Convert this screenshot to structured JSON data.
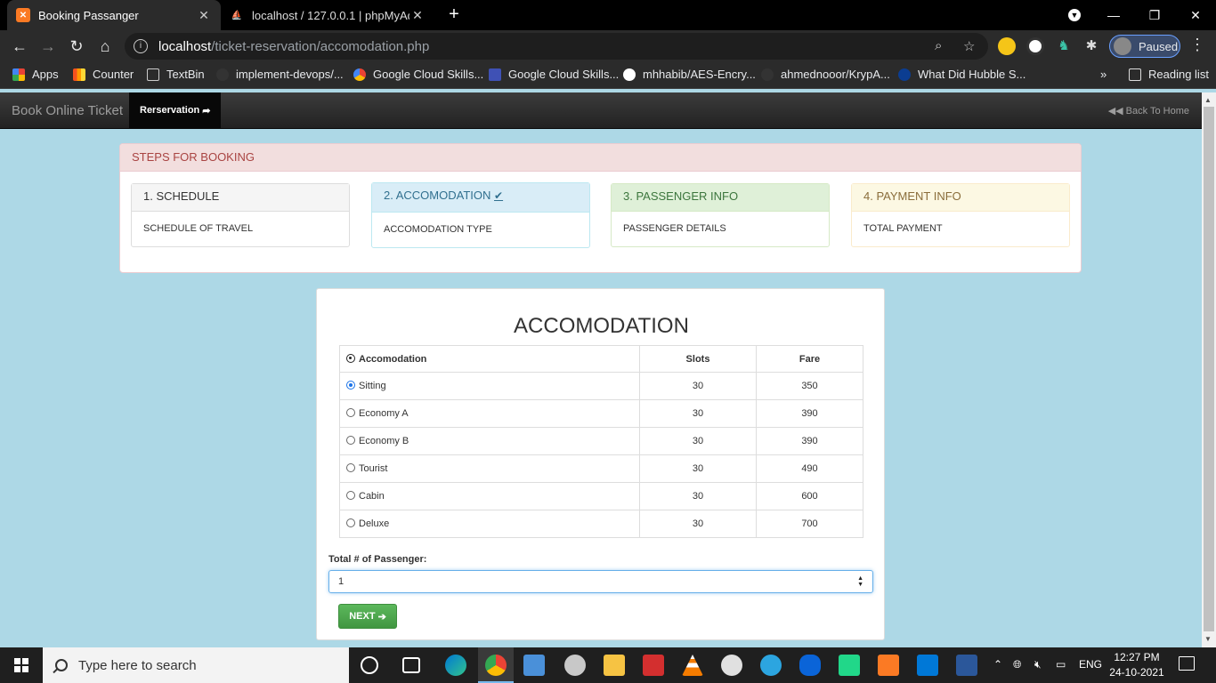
{
  "browser": {
    "tabs": [
      {
        "title": "Booking Passanger",
        "active": true
      },
      {
        "title": "localhost / 127.0.0.1 | phpMyAdm",
        "active": false
      }
    ],
    "url_host": "localhost",
    "url_path": "/ticket-reservation/accomodation.php",
    "profile_label": "Paused",
    "bookmarks": [
      "Apps",
      "Counter",
      "TextBin",
      "implement-devops/...",
      "Google Cloud Skills...",
      "Google Cloud Skills...",
      "mhhabib/AES-Encry...",
      "ahmednooor/KrypA...",
      "What Did Hubble S..."
    ],
    "reading_list": "Reading list",
    "overflow": "»"
  },
  "nav": {
    "brand": "Book Online Ticket",
    "active": "Rerservation",
    "back": "Back To Home"
  },
  "steps": {
    "heading": "STEPS FOR BOOKING",
    "items": [
      {
        "title": "1. SCHEDULE",
        "body": "SCHEDULE OF TRAVEL"
      },
      {
        "title": "2. ACCOMODATION",
        "body": "ACCOMODATION TYPE"
      },
      {
        "title": "3. PASSENGER INFO",
        "body": "PASSENGER DETAILS"
      },
      {
        "title": "4. PAYMENT INFO",
        "body": "TOTAL PAYMENT"
      }
    ]
  },
  "form": {
    "title": "ACCOMODATION",
    "columns": [
      "Accomodation",
      "Slots",
      "Fare"
    ],
    "rows": [
      {
        "name": "Sitting",
        "slots": "30",
        "fare": "350",
        "selected": true
      },
      {
        "name": "Economy A",
        "slots": "30",
        "fare": "390",
        "selected": false
      },
      {
        "name": "Economy B",
        "slots": "30",
        "fare": "390",
        "selected": false
      },
      {
        "name": "Tourist",
        "slots": "30",
        "fare": "490",
        "selected": false
      },
      {
        "name": "Cabin",
        "slots": "30",
        "fare": "600",
        "selected": false
      },
      {
        "name": "Deluxe",
        "slots": "30",
        "fare": "700",
        "selected": false
      }
    ],
    "passenger_label": "Total # of Passenger:",
    "passenger_value": "1",
    "next_label": "NEXT"
  },
  "taskbar": {
    "search_placeholder": "Type here to search",
    "lang": "ENG",
    "time": "12:27 PM",
    "date": "24-10-2021"
  },
  "colors": {
    "page_bg": "#add8e6",
    "next_button": "#5cb85c",
    "steps_heading": "#a94442"
  }
}
